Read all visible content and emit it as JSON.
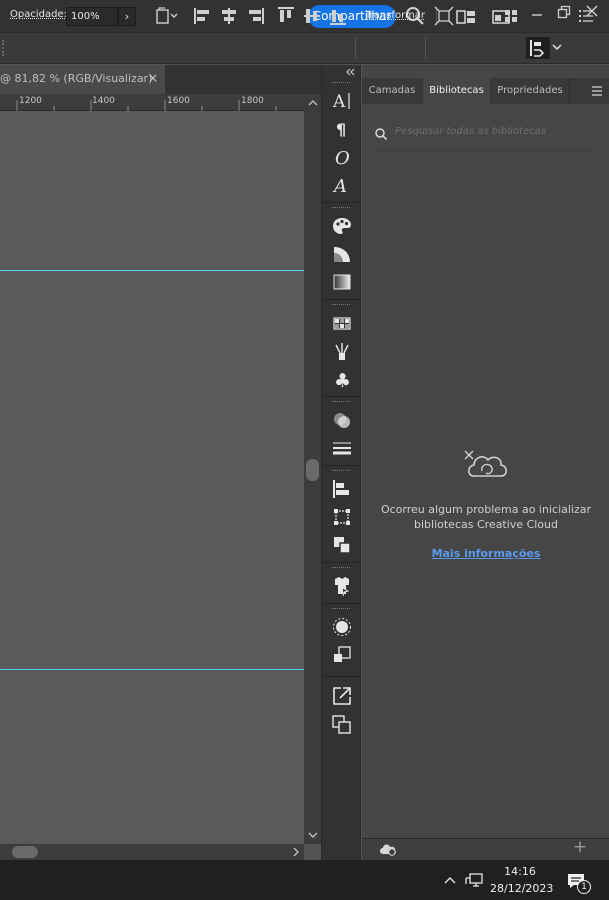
{
  "titlebar": {
    "share_label": "Compartilhar",
    "icons": [
      "search-icon",
      "workspace-layout-icon",
      "window-arrange-icon",
      "minimize-icon",
      "restore-icon",
      "close-icon"
    ]
  },
  "controlbar": {
    "opacity_label": "Opacidade:",
    "opacity_value": "100%",
    "transform_label": "Transformar"
  },
  "document": {
    "tab_title": "@ 81,82 % (RGB/Visualizar)",
    "close_glyph": "×",
    "ruler_labels": [
      "1200",
      "1400",
      "1600",
      "1800"
    ]
  },
  "panel": {
    "tabs": [
      "Camadas",
      "Bibliotecas",
      "Propriedades"
    ],
    "active_tab": "Bibliotecas",
    "search_placeholder": "Pesquisar todas as bibliotecas",
    "error_line1": "Ocorreu algum problema ao inicializar",
    "error_line2": "bibliotecas Creative Cloud",
    "more_info_link": "Mais informações",
    "footer_add": "+"
  },
  "taskbar": {
    "time": "14:16",
    "date": "28/12/2023",
    "notification_count": "1"
  },
  "colors": {
    "accent": "#1473e6",
    "guide": "#4fd3e6",
    "link": "#5a9bf0"
  }
}
